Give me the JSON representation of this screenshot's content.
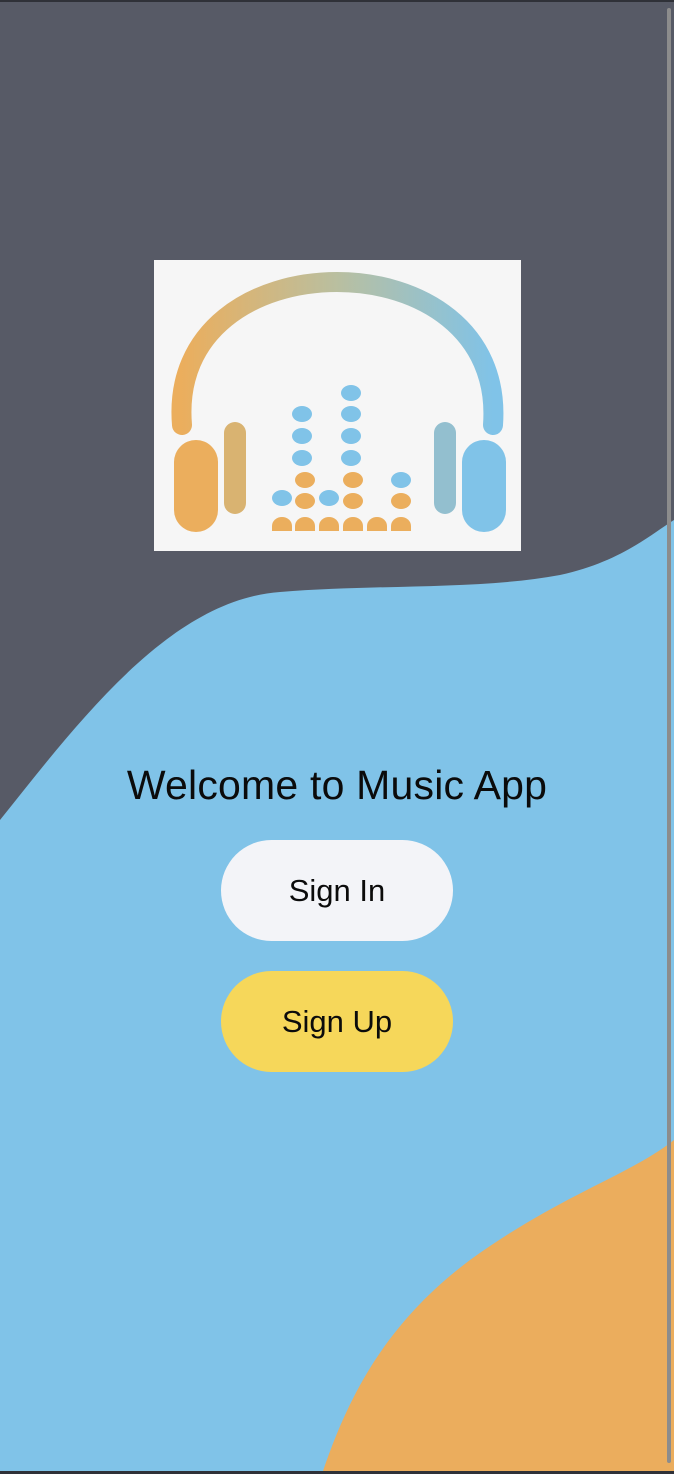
{
  "app": {
    "welcome_text": "Welcome to Music App"
  },
  "buttons": {
    "sign_in_label": "Sign In",
    "sign_up_label": "Sign Up"
  },
  "logo": {
    "icon": "headphones-equalizer-logo"
  },
  "colors": {
    "background_dark": "#575a66",
    "wave_blue": "#80c3e8",
    "wave_orange": "#ebad5d",
    "sign_in_button": "#f3f4f8",
    "sign_up_button": "#f6d75a"
  }
}
